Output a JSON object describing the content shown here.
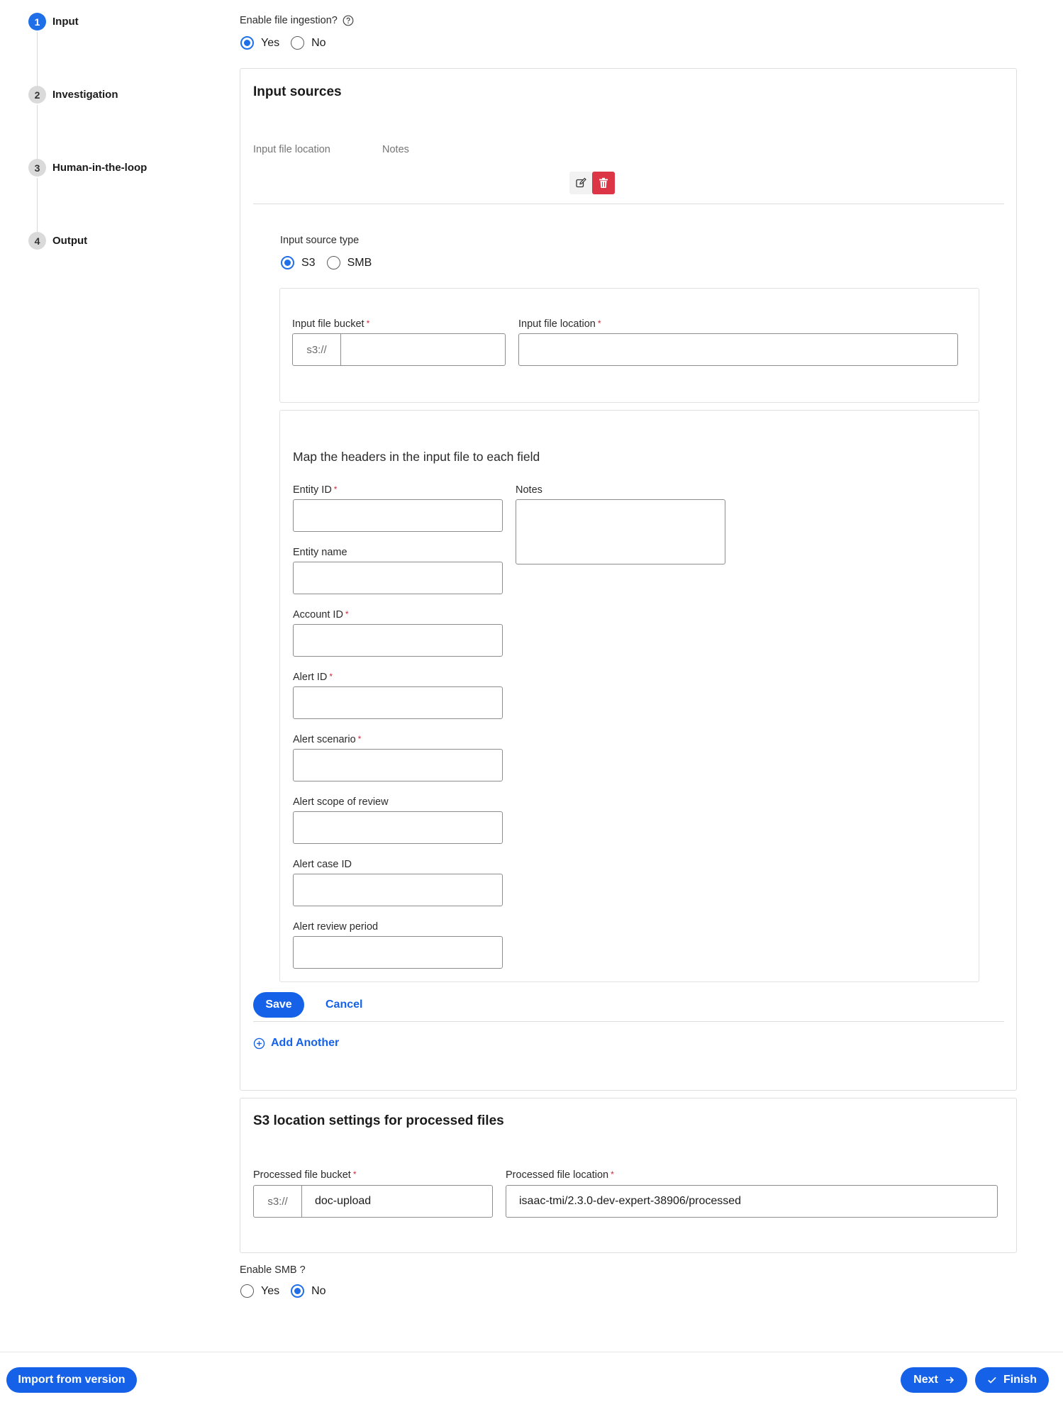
{
  "stepper": {
    "steps": [
      {
        "number": "1",
        "label": "Input"
      },
      {
        "number": "2",
        "label": "Investigation"
      },
      {
        "number": "3",
        "label": "Human-in-the-loop"
      },
      {
        "number": "4",
        "label": "Output"
      }
    ],
    "active_step": 1
  },
  "file_ingestion": {
    "question": "Enable file ingestion?",
    "options": [
      "Yes",
      "No"
    ],
    "selected": "Yes"
  },
  "input_sources": {
    "title": "Input sources",
    "columns": [
      "Input file location",
      "Notes"
    ],
    "row_actions": [
      "edit-icon",
      "trash-icon"
    ],
    "source_type_label": "Input source type",
    "source_type_options": [
      "S3",
      "SMB"
    ],
    "source_type_selected": "S3",
    "bucket_label": "Input file bucket",
    "bucket_prefix": "s3://",
    "bucket_value": "",
    "location_label": "Input file location",
    "location_value": "",
    "mapping_title": "Map the headers in the input file to each field",
    "fields": [
      {
        "label": "Entity ID",
        "required": "*",
        "value": ""
      },
      {
        "label": "Entity name",
        "required": "",
        "value": ""
      },
      {
        "label": "Account ID",
        "required": "*",
        "value": ""
      },
      {
        "label": "Alert ID",
        "required": "*",
        "value": ""
      },
      {
        "label": "Alert scenario",
        "required": "*",
        "value": ""
      },
      {
        "label": "Alert scope of review",
        "required": "",
        "value": ""
      },
      {
        "label": "Alert case ID",
        "required": "",
        "value": ""
      },
      {
        "label": "Alert review period",
        "required": "",
        "value": ""
      }
    ],
    "notes_label": "Notes",
    "notes_value": "",
    "save_label": "Save",
    "cancel_label": "Cancel",
    "add_another_label": "Add Another"
  },
  "processed": {
    "title": "S3 location settings for processed files",
    "bucket_label": "Processed file bucket",
    "bucket_prefix": "s3://",
    "bucket_value": "doc-upload",
    "location_label": "Processed file location",
    "location_value": "isaac-tmi/2.3.0-dev-expert-38906/processed"
  },
  "smb": {
    "question": "Enable SMB ?",
    "options": [
      "Yes",
      "No"
    ],
    "selected": "No"
  },
  "footer": {
    "import_label": "Import from version",
    "next_label": "Next",
    "finish_label": "Finish"
  },
  "colors": {
    "accent": "#1562e8",
    "danger": "#dc3545",
    "required": "#d0283c"
  }
}
